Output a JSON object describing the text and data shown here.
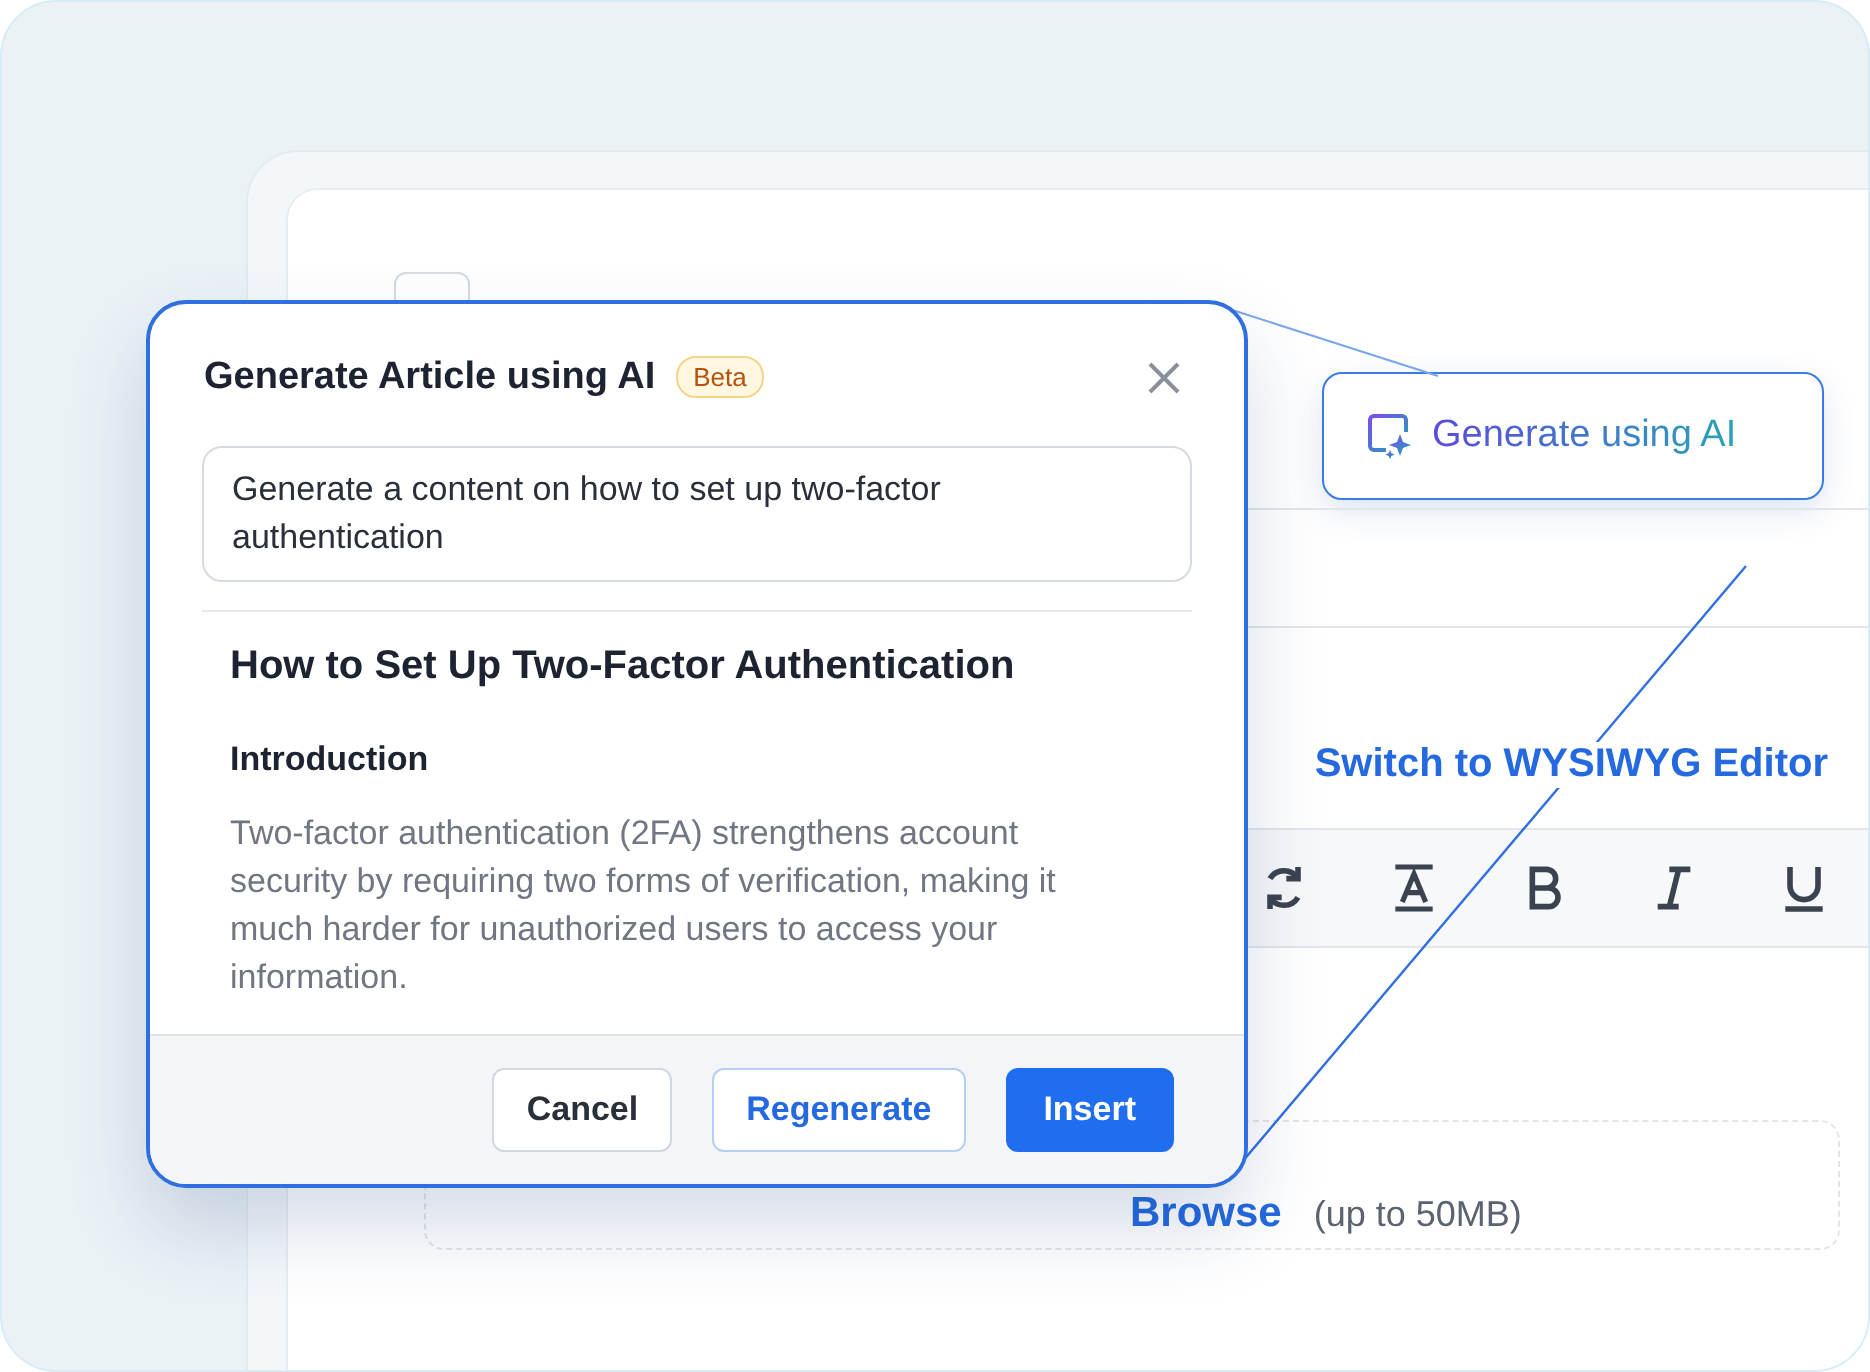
{
  "editor": {
    "ai_button": "Generate using AI",
    "switch_link": "Switch to WYSIWYG Editor",
    "upload": {
      "link": "Browse",
      "limit": "(up to 50MB)"
    }
  },
  "dialog": {
    "title": "Generate Article using AI",
    "badge": "Beta",
    "prompt": "Generate a content on how to set up two-factor authentication",
    "article": {
      "heading": "How to Set Up Two-Factor Authentication",
      "subheading": "Introduction",
      "paragraph": "Two-factor authentication (2FA) strengthens account security by requiring two forms of verification, making it much harder for unauthorized users to access your information."
    },
    "buttons": [
      {
        "label": "Cancel",
        "kind": "secondary"
      },
      {
        "label": "Regenerate",
        "kind": "outline"
      },
      {
        "label": "Insert",
        "kind": "primary"
      }
    ]
  }
}
